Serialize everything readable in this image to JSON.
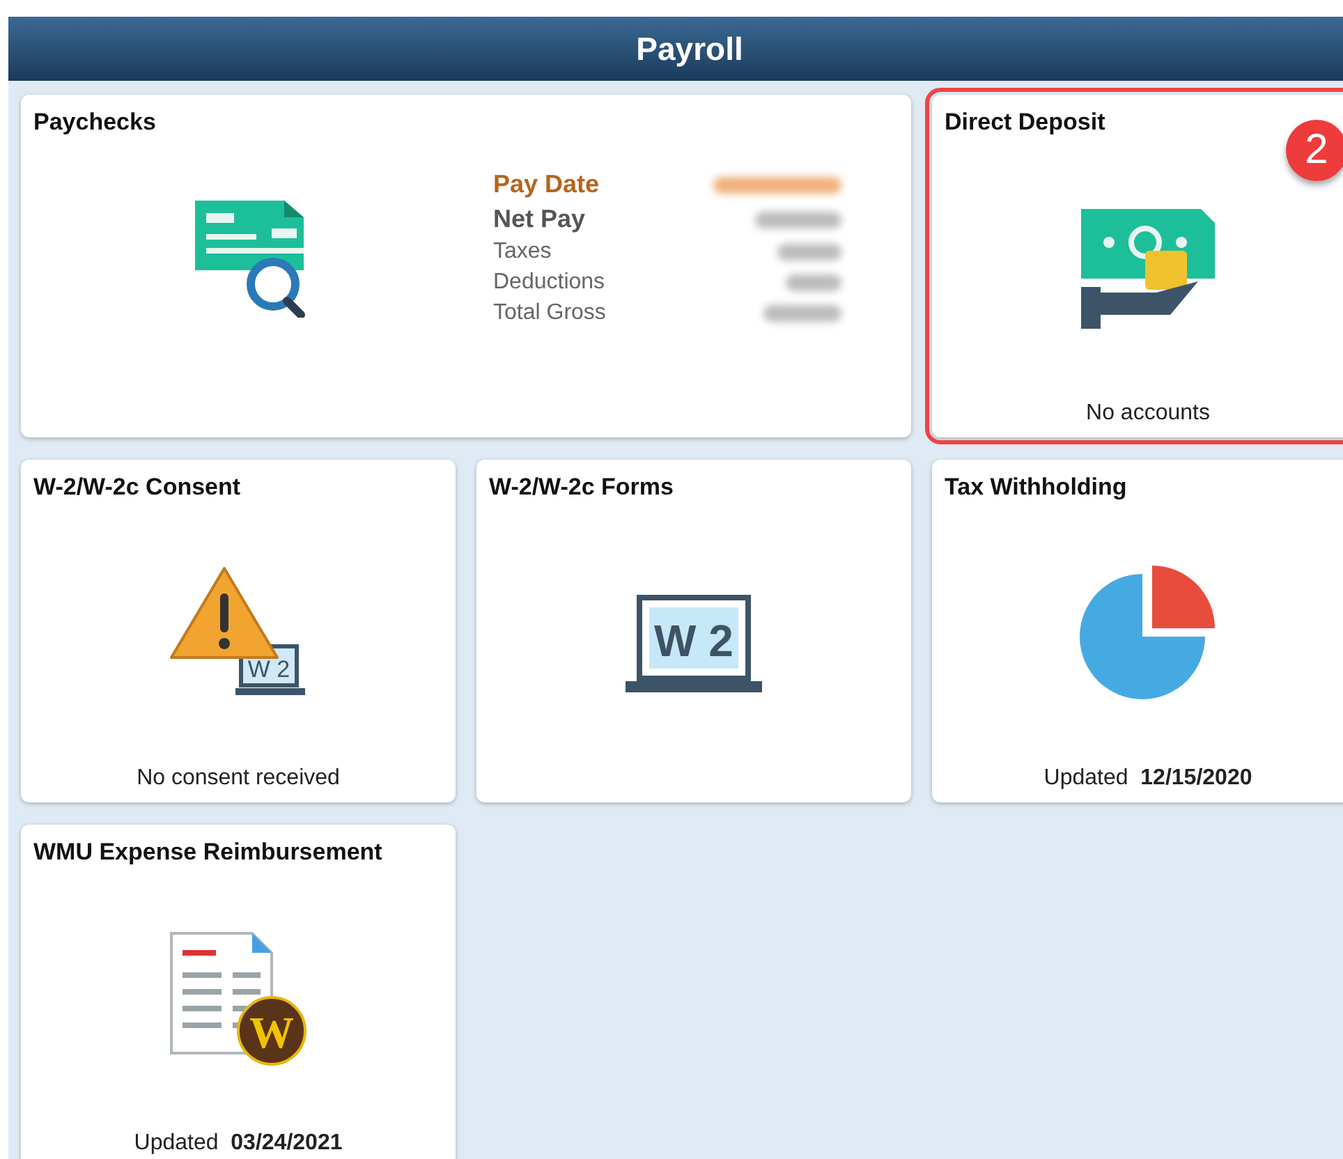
{
  "header": {
    "title": "Payroll"
  },
  "tiles": [
    {
      "kind": "paychecks",
      "title": "Paychecks",
      "highlighted": false,
      "summary": [
        {
          "kind": "highlight",
          "label": "Pay Date"
        },
        {
          "kind": "emphasis",
          "label": "Net Pay"
        },
        {
          "kind": "plain",
          "label": "Taxes"
        },
        {
          "kind": "plain",
          "label": "Deductions"
        },
        {
          "kind": "plain",
          "label": "Total Gross"
        }
      ]
    },
    {
      "kind": "deposit",
      "title": "Direct Deposit",
      "highlighted": true,
      "badge": "2",
      "footer": {
        "label": "No accounts"
      }
    },
    {
      "kind": "consent",
      "title": "W-2/W-2c Consent",
      "highlighted": false,
      "icon_text": "W 2",
      "footer": {
        "label": "No consent received"
      }
    },
    {
      "kind": "forms",
      "title": "W-2/W-2c Forms",
      "highlighted": false,
      "icon_text": "W 2"
    },
    {
      "kind": "tax",
      "title": "Tax Withholding",
      "highlighted": false,
      "footer": {
        "label": "Updated",
        "value": "12/15/2020"
      }
    },
    {
      "kind": "expense",
      "title": "WMU Expense Reimbursement",
      "highlighted": false,
      "icon_text": "W",
      "footer": {
        "label": "Updated",
        "value": "03/24/2021"
      }
    }
  ]
}
